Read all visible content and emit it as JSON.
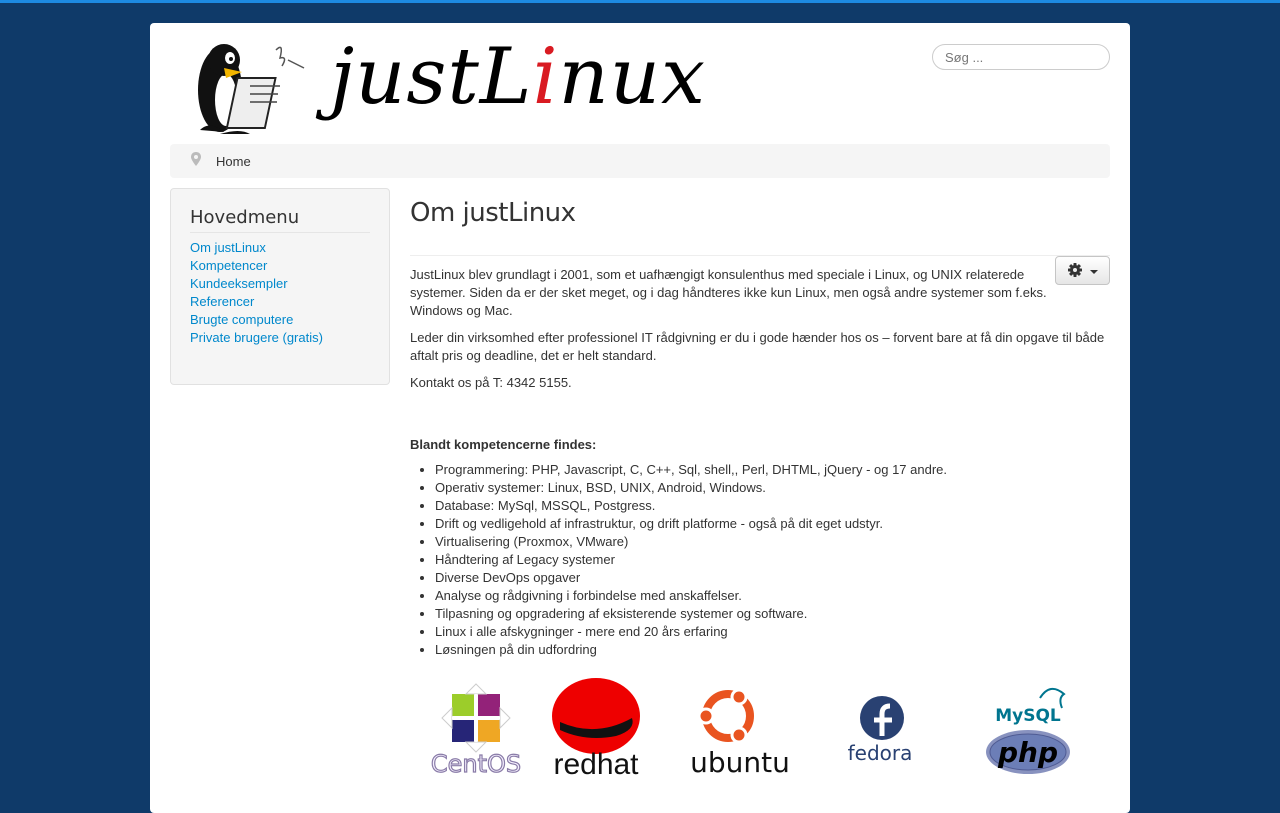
{
  "header": {
    "logo_text_pre": "justL",
    "logo_text_i": "i",
    "logo_text_post": "nux",
    "search_placeholder": "Søg ..."
  },
  "breadcrumb": {
    "icon": "map-pin-icon",
    "home_label": "Home"
  },
  "sidebar": {
    "title": "Hovedmenu",
    "items": [
      {
        "label": "Om justLinux"
      },
      {
        "label": "Kompetencer"
      },
      {
        "label": "Kundeeksempler"
      },
      {
        "label": "Referencer"
      },
      {
        "label": "Brugte computere"
      },
      {
        "label": "Private brugere (gratis)"
      }
    ]
  },
  "article": {
    "title": "Om justLinux",
    "tools_icon": "gear-icon",
    "paragraphs": [
      "JustLinux blev grundlagt i 2001, som et uafhængigt konsulenthus med speciale i Linux, og UNIX relaterede systemer. Siden da er der sket meget, og i dag håndteres ikke kun Linux, men også andre systemer som f.eks. Windows og Mac.",
      "Leder din virksomhed efter professionel IT rådgivning er du i gode hænder hos os – forvent bare at få din opgave til både aftalt pris og deadline, det er helt standard.",
      "Kontakt os på T: 4342 5155."
    ],
    "competence_heading": "Blandt kompetencerne findes:",
    "competences": [
      "Programmering: PHP, Javascript, C, C++, Sql, shell,, Perl, DHTML, jQuery - og 17 andre.",
      "Operativ systemer: Linux, BSD, UNIX, Android, Windows.",
      "Database: MySql, MSSQL, Postgress.",
      "Drift og vedligehold af infrastruktur, og drift platforme - også på dit eget udstyr.",
      "Virtualisering (Proxmox, VMware)",
      "Håndtering af Legacy systemer",
      "Diverse DevOps opgaver",
      "Analyse og rådgivning i forbindelse med anskaffelser.",
      "Tilpasning og opgradering af eksisterende systemer og software.",
      "Linux i alle afskygninger - mere end 20 års erfaring",
      "Løsningen på din udfordring"
    ]
  },
  "logos": {
    "centos": "CentOS",
    "redhat": "redhat",
    "ubuntu": "ubuntu",
    "fedora": "fedora",
    "mysql": "MySQL",
    "php": "php"
  },
  "colors": {
    "background": "#0f3a69",
    "top_bar": "#1d8ae2",
    "link": "#0088cc",
    "logo_red": "#d91b22"
  }
}
